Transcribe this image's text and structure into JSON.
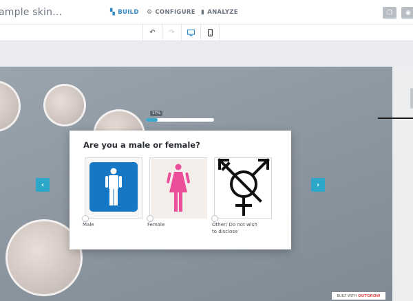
{
  "header": {
    "title": "ample skin...",
    "tabs": [
      {
        "label": "BUILD",
        "icon": "grid-icon",
        "active": true
      },
      {
        "label": "CONFIGURE",
        "icon": "gear-icon",
        "active": false
      },
      {
        "label": "ANALYZE",
        "icon": "bar-chart-icon",
        "active": false
      }
    ]
  },
  "toolbar": {
    "buttons": [
      "undo-icon",
      "redo-icon",
      "desktop-icon",
      "mobile-icon"
    ]
  },
  "progress": {
    "label": "17%",
    "value": 0.17
  },
  "question": {
    "text": "Are you a male or female?",
    "options": [
      {
        "label": "Male"
      },
      {
        "label": "Female"
      },
      {
        "label": "Other/ Do not wish",
        "label2": "to disclose"
      }
    ]
  },
  "footer": {
    "built_with": "BUILT WITH",
    "brand": "OUTGROW"
  },
  "colors": {
    "accent": "#2f89c7",
    "teal": "#2ca7c9",
    "male_blue": "#1677c4",
    "female_pink": "#ec4f9a"
  }
}
